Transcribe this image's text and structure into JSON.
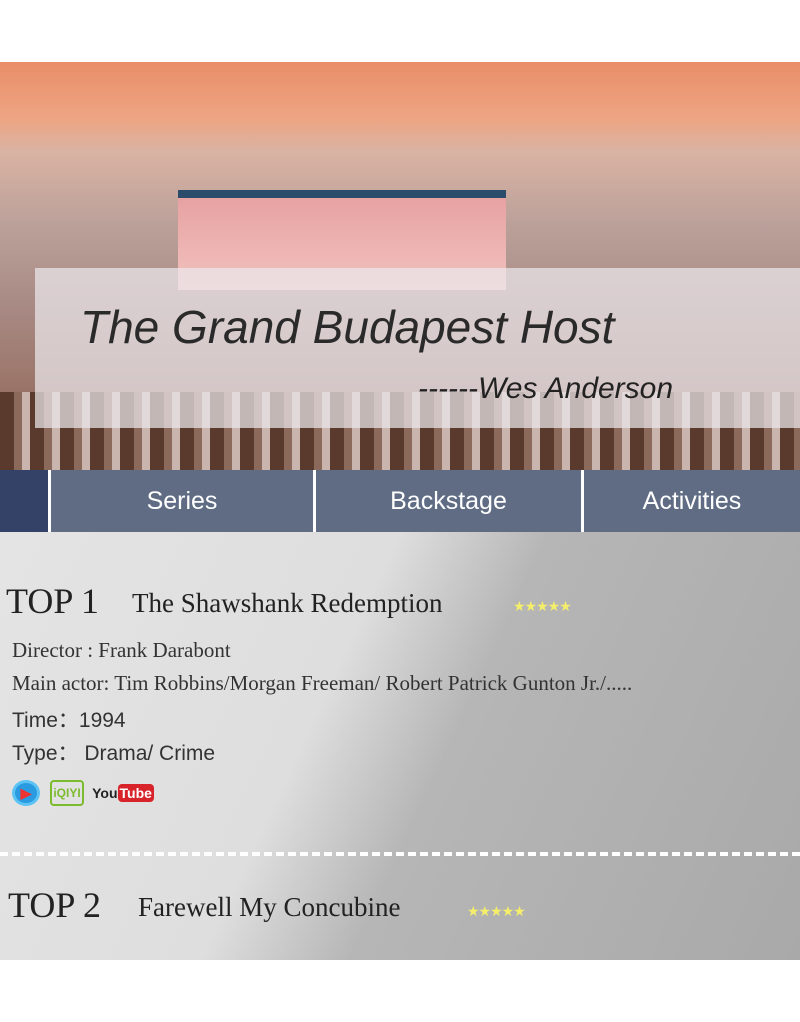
{
  "banner": {
    "title": "The Grand Budapest Host",
    "author": "------Wes Anderson"
  },
  "nav": {
    "items": [
      {
        "label": "Series"
      },
      {
        "label": "Backstage"
      },
      {
        "label": "Activities"
      }
    ]
  },
  "movies": [
    {
      "rank": "TOP 1",
      "title": "The Shawshank Redemption",
      "stars": "★★★★★",
      "director": "Director : Frank Darabont",
      "actors": "Main actor: Tim Robbins/Morgan Freeman/ Robert Patrick Gunton Jr./.....",
      "time": "Time：1994",
      "type": "Type：  Drama/ Crime",
      "platforms": [
        "youku-icon",
        "iqiyi",
        "YouTube"
      ]
    },
    {
      "rank": "TOP 2",
      "title": "Farewell My Concubine",
      "stars": "★★★★★"
    }
  ],
  "icons": {
    "iqiyi": "iQIYI",
    "you": "You",
    "tube": "Tube"
  }
}
